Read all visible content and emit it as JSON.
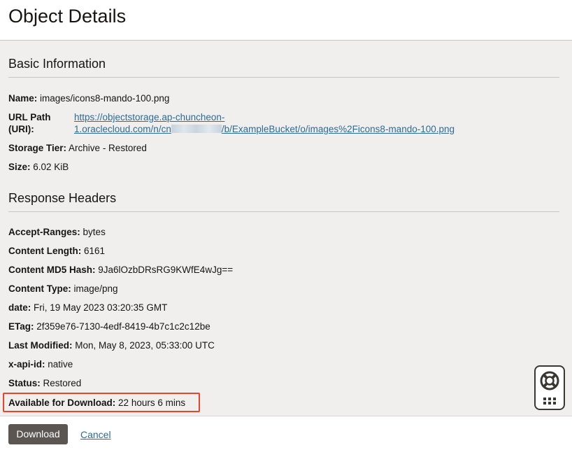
{
  "page": {
    "title": "Object Details"
  },
  "basic": {
    "heading": "Basic Information",
    "name_label": "Name:",
    "name_value": "images/icons8-mando-100.png",
    "url_label_line1": "URL Path",
    "url_label_line2": "(URI):",
    "url_line1": "https://objectstorage.ap-chuncheon-",
    "url_line2_prefix": "1.oraclecloud.com/n/cn",
    "url_line2_suffix": "/b/ExampleBucket/o/images%2Ficons8-mando-100.png",
    "tier_label": "Storage Tier:",
    "tier_value": "Archive - Restored",
    "size_label": "Size:",
    "size_value": "6.02 KiB"
  },
  "headers": {
    "heading": "Response Headers",
    "rows": [
      {
        "label": "Accept-Ranges:",
        "value": "bytes"
      },
      {
        "label": "Content Length:",
        "value": "6161"
      },
      {
        "label": "Content MD5 Hash:",
        "value": "9Ja6lOzbDRsRG9KWfE4wJg=="
      },
      {
        "label": "Content Type:",
        "value": "image/png"
      },
      {
        "label": "date:",
        "value": "Fri, 19 May 2023 03:20:35 GMT"
      },
      {
        "label": "ETag:",
        "value": "2f359e76-7130-4edf-8419-4b7c1c2c12be"
      },
      {
        "label": "Last Modified:",
        "value": "Mon, May 8, 2023, 05:33:00 UTC"
      },
      {
        "label": "x-api-id:",
        "value": "native"
      },
      {
        "label": "Status:",
        "value": "Restored"
      },
      {
        "label": "Available for Download:",
        "value": "22 hours 6 mins"
      }
    ]
  },
  "footer": {
    "download_label": "Download",
    "cancel_label": "Cancel"
  },
  "colors": {
    "highlight": "#e8442a",
    "link": "#2a6b9a",
    "button": "#5b5652"
  },
  "icons": {
    "help": "lifebuoy-icon",
    "apps": "grid-icon"
  }
}
